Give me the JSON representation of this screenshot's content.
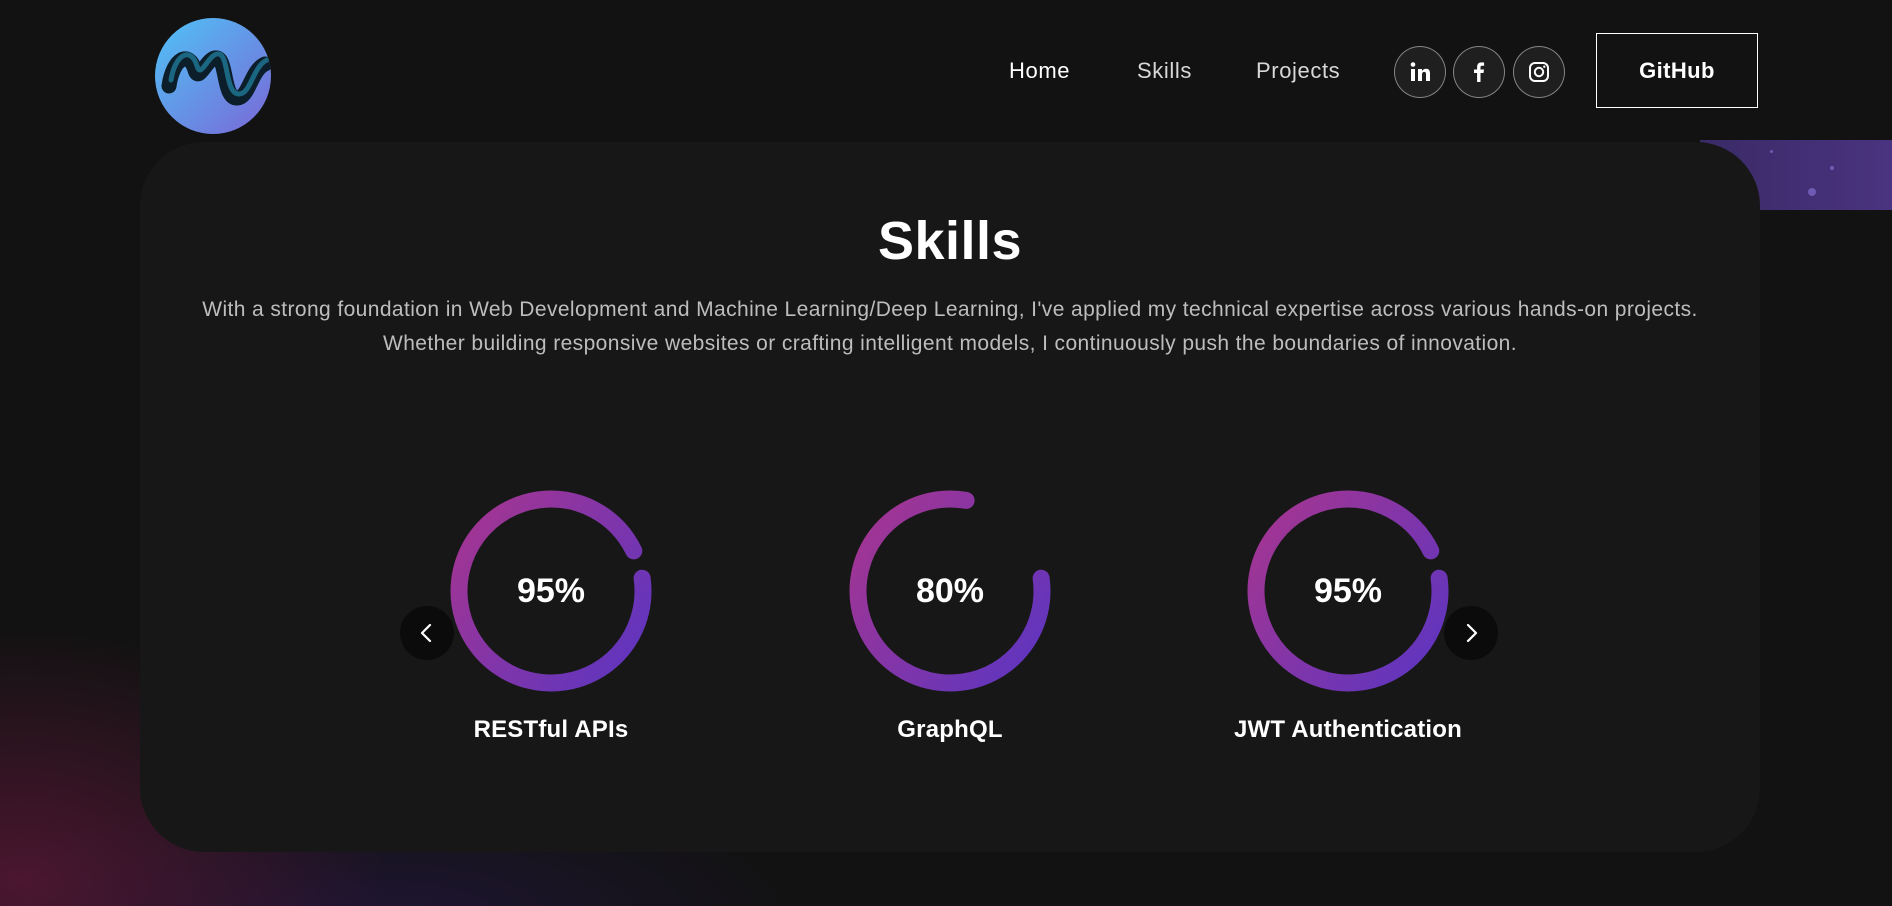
{
  "nav": {
    "links": [
      "Home",
      "Skills",
      "Projects"
    ],
    "socials": [
      "linkedin-icon",
      "facebook-icon",
      "instagram-icon"
    ],
    "github_label": "GitHub"
  },
  "skills": {
    "title": "Skills",
    "description": "With a strong foundation in Web Development and Machine Learning/Deep Learning, I've applied my technical expertise across various hands-on projects. Whether building responsive websites or crafting intelligent models, I continuously push the boundaries of innovation.",
    "items": [
      {
        "label": "RESTful APIs",
        "percent_text": "95%",
        "percent": 95
      },
      {
        "label": "GraphQL",
        "percent_text": "80%",
        "percent": 80
      },
      {
        "label": "JWT Authentication",
        "percent_text": "95%",
        "percent": 95
      }
    ]
  },
  "colors": {
    "background": "#121212",
    "card": "#171717",
    "ring_start": "#a8358f",
    "ring_end": "#5a35c2",
    "logo_start": "#4fc3f7",
    "logo_end": "#7a67d6"
  }
}
